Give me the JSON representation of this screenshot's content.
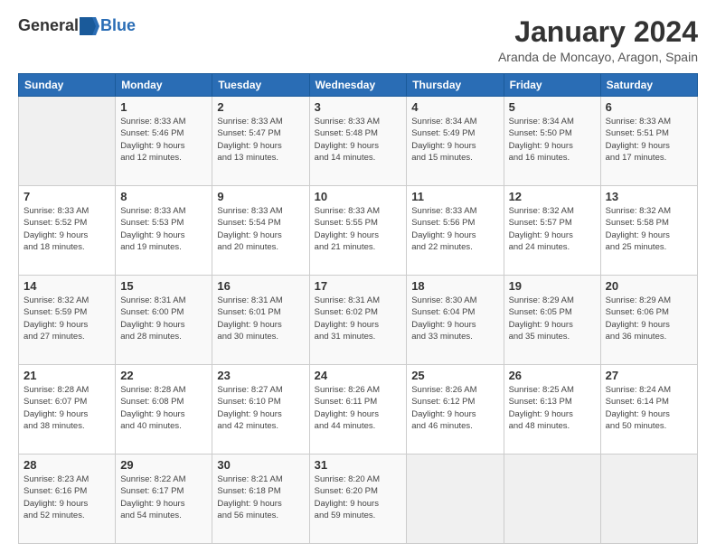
{
  "logo": {
    "general": "General",
    "blue": "Blue"
  },
  "title": "January 2024",
  "subtitle": "Aranda de Moncayo, Aragon, Spain",
  "headers": [
    "Sunday",
    "Monday",
    "Tuesday",
    "Wednesday",
    "Thursday",
    "Friday",
    "Saturday"
  ],
  "weeks": [
    [
      {
        "day": "",
        "empty": true
      },
      {
        "day": "1",
        "sunrise": "Sunrise: 8:33 AM",
        "sunset": "Sunset: 5:46 PM",
        "daylight": "Daylight: 9 hours and 12 minutes."
      },
      {
        "day": "2",
        "sunrise": "Sunrise: 8:33 AM",
        "sunset": "Sunset: 5:47 PM",
        "daylight": "Daylight: 9 hours and 13 minutes."
      },
      {
        "day": "3",
        "sunrise": "Sunrise: 8:33 AM",
        "sunset": "Sunset: 5:48 PM",
        "daylight": "Daylight: 9 hours and 14 minutes."
      },
      {
        "day": "4",
        "sunrise": "Sunrise: 8:34 AM",
        "sunset": "Sunset: 5:49 PM",
        "daylight": "Daylight: 9 hours and 15 minutes."
      },
      {
        "day": "5",
        "sunrise": "Sunrise: 8:34 AM",
        "sunset": "Sunset: 5:50 PM",
        "daylight": "Daylight: 9 hours and 16 minutes."
      },
      {
        "day": "6",
        "sunrise": "Sunrise: 8:33 AM",
        "sunset": "Sunset: 5:51 PM",
        "daylight": "Daylight: 9 hours and 17 minutes."
      }
    ],
    [
      {
        "day": "7",
        "sunrise": "Sunrise: 8:33 AM",
        "sunset": "Sunset: 5:52 PM",
        "daylight": "Daylight: 9 hours and 18 minutes."
      },
      {
        "day": "8",
        "sunrise": "Sunrise: 8:33 AM",
        "sunset": "Sunset: 5:53 PM",
        "daylight": "Daylight: 9 hours and 19 minutes."
      },
      {
        "day": "9",
        "sunrise": "Sunrise: 8:33 AM",
        "sunset": "Sunset: 5:54 PM",
        "daylight": "Daylight: 9 hours and 20 minutes."
      },
      {
        "day": "10",
        "sunrise": "Sunrise: 8:33 AM",
        "sunset": "Sunset: 5:55 PM",
        "daylight": "Daylight: 9 hours and 21 minutes."
      },
      {
        "day": "11",
        "sunrise": "Sunrise: 8:33 AM",
        "sunset": "Sunset: 5:56 PM",
        "daylight": "Daylight: 9 hours and 22 minutes."
      },
      {
        "day": "12",
        "sunrise": "Sunrise: 8:32 AM",
        "sunset": "Sunset: 5:57 PM",
        "daylight": "Daylight: 9 hours and 24 minutes."
      },
      {
        "day": "13",
        "sunrise": "Sunrise: 8:32 AM",
        "sunset": "Sunset: 5:58 PM",
        "daylight": "Daylight: 9 hours and 25 minutes."
      }
    ],
    [
      {
        "day": "14",
        "sunrise": "Sunrise: 8:32 AM",
        "sunset": "Sunset: 5:59 PM",
        "daylight": "Daylight: 9 hours and 27 minutes."
      },
      {
        "day": "15",
        "sunrise": "Sunrise: 8:31 AM",
        "sunset": "Sunset: 6:00 PM",
        "daylight": "Daylight: 9 hours and 28 minutes."
      },
      {
        "day": "16",
        "sunrise": "Sunrise: 8:31 AM",
        "sunset": "Sunset: 6:01 PM",
        "daylight": "Daylight: 9 hours and 30 minutes."
      },
      {
        "day": "17",
        "sunrise": "Sunrise: 8:31 AM",
        "sunset": "Sunset: 6:02 PM",
        "daylight": "Daylight: 9 hours and 31 minutes."
      },
      {
        "day": "18",
        "sunrise": "Sunrise: 8:30 AM",
        "sunset": "Sunset: 6:04 PM",
        "daylight": "Daylight: 9 hours and 33 minutes."
      },
      {
        "day": "19",
        "sunrise": "Sunrise: 8:29 AM",
        "sunset": "Sunset: 6:05 PM",
        "daylight": "Daylight: 9 hours and 35 minutes."
      },
      {
        "day": "20",
        "sunrise": "Sunrise: 8:29 AM",
        "sunset": "Sunset: 6:06 PM",
        "daylight": "Daylight: 9 hours and 36 minutes."
      }
    ],
    [
      {
        "day": "21",
        "sunrise": "Sunrise: 8:28 AM",
        "sunset": "Sunset: 6:07 PM",
        "daylight": "Daylight: 9 hours and 38 minutes."
      },
      {
        "day": "22",
        "sunrise": "Sunrise: 8:28 AM",
        "sunset": "Sunset: 6:08 PM",
        "daylight": "Daylight: 9 hours and 40 minutes."
      },
      {
        "day": "23",
        "sunrise": "Sunrise: 8:27 AM",
        "sunset": "Sunset: 6:10 PM",
        "daylight": "Daylight: 9 hours and 42 minutes."
      },
      {
        "day": "24",
        "sunrise": "Sunrise: 8:26 AM",
        "sunset": "Sunset: 6:11 PM",
        "daylight": "Daylight: 9 hours and 44 minutes."
      },
      {
        "day": "25",
        "sunrise": "Sunrise: 8:26 AM",
        "sunset": "Sunset: 6:12 PM",
        "daylight": "Daylight: 9 hours and 46 minutes."
      },
      {
        "day": "26",
        "sunrise": "Sunrise: 8:25 AM",
        "sunset": "Sunset: 6:13 PM",
        "daylight": "Daylight: 9 hours and 48 minutes."
      },
      {
        "day": "27",
        "sunrise": "Sunrise: 8:24 AM",
        "sunset": "Sunset: 6:14 PM",
        "daylight": "Daylight: 9 hours and 50 minutes."
      }
    ],
    [
      {
        "day": "28",
        "sunrise": "Sunrise: 8:23 AM",
        "sunset": "Sunset: 6:16 PM",
        "daylight": "Daylight: 9 hours and 52 minutes."
      },
      {
        "day": "29",
        "sunrise": "Sunrise: 8:22 AM",
        "sunset": "Sunset: 6:17 PM",
        "daylight": "Daylight: 9 hours and 54 minutes."
      },
      {
        "day": "30",
        "sunrise": "Sunrise: 8:21 AM",
        "sunset": "Sunset: 6:18 PM",
        "daylight": "Daylight: 9 hours and 56 minutes."
      },
      {
        "day": "31",
        "sunrise": "Sunrise: 8:20 AM",
        "sunset": "Sunset: 6:20 PM",
        "daylight": "Daylight: 9 hours and 59 minutes."
      },
      {
        "day": "",
        "empty": true
      },
      {
        "day": "",
        "empty": true
      },
      {
        "day": "",
        "empty": true
      }
    ]
  ]
}
